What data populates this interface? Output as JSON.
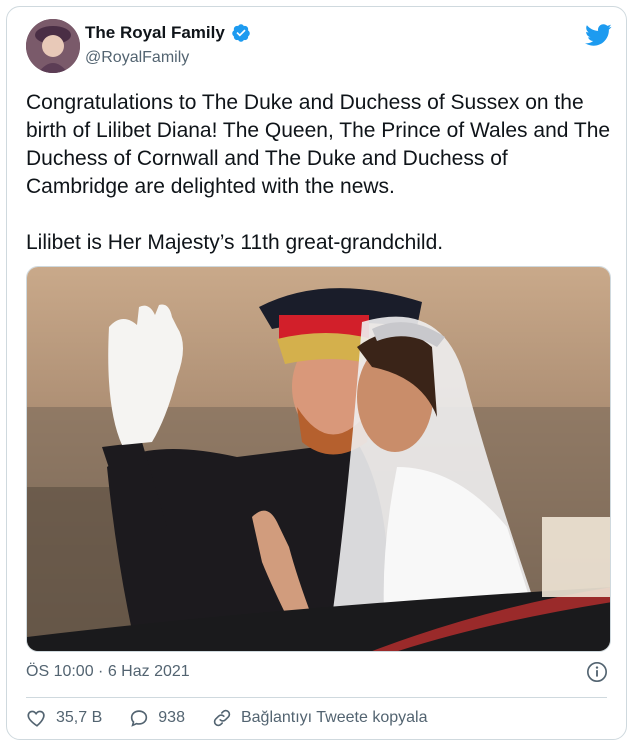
{
  "author": {
    "name": "The Royal Family",
    "handle": "@RoyalFamily"
  },
  "tweet": {
    "text": "Congratulations to The Duke and Duchess of Sussex on the birth of Lilibet Diana! The Queen, The Prince of Wales and The Duchess of Cornwall and The Duke and Duchess of Cambridge are delighted with the news.\n\nLilibet is Her Majesty’s 11th great-grandchild.",
    "timestamp": "ÖS 10:00 · 6 Haz 2021"
  },
  "actions": {
    "likes": "35,7 B",
    "replies": "938",
    "copy_link_label": "Bağlantıyı Tweete kopyala"
  },
  "icons": {
    "bird": "twitter-bird-icon",
    "verified": "verified-badge-icon",
    "info": "info-icon",
    "like": "heart-icon",
    "reply": "speech-bubble-icon",
    "link": "link-icon"
  },
  "colors": {
    "accent": "#1d9bf0",
    "text_primary": "#0f1419",
    "text_secondary": "#536471",
    "border": "#cfd9de"
  }
}
